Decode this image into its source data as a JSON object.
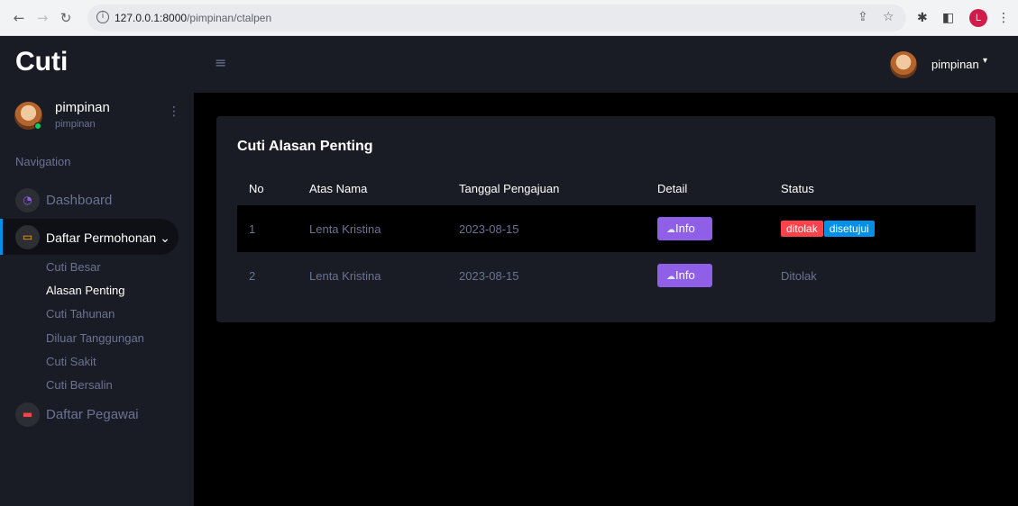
{
  "browser": {
    "url_host": "127.0.0.1:8000",
    "url_path": "/pimpinan/ctalpen",
    "profile_initial": "L"
  },
  "sidebar": {
    "brand": "Cuti",
    "profile": {
      "name": "pimpinan",
      "role": "pimpinan"
    },
    "nav_category": "Navigation",
    "items": [
      {
        "label": "Dashboard",
        "icon": "speedometer-icon",
        "color": "#8f5fe8"
      },
      {
        "label": "Daftar Permohonan ⌄",
        "icon": "laptop-icon",
        "color": "#ffab00"
      },
      {
        "label": "Daftar Pegawai",
        "icon": "chat-icon",
        "color": "#fc424a"
      }
    ],
    "sub_items": [
      {
        "label": "Cuti Besar"
      },
      {
        "label": "Alasan Penting"
      },
      {
        "label": "Cuti Tahunan"
      },
      {
        "label": "Diluar Tanggungan"
      },
      {
        "label": "Cuti Sakit"
      },
      {
        "label": "Cuti Bersalin"
      }
    ]
  },
  "topbar": {
    "username": "pimpinan"
  },
  "main": {
    "card_title": "Cuti Alasan Penting",
    "columns": [
      "No",
      "Atas Nama",
      "Tanggal Pengajuan",
      "Detail",
      "Status"
    ],
    "rows": [
      {
        "no": "1",
        "name": "Lenta Kristina",
        "date": "2023-08-15",
        "detail": "Info",
        "status_badges": [
          "ditolak",
          "disetujui"
        ]
      },
      {
        "no": "2",
        "name": "Lenta Kristina",
        "date": "2023-08-15",
        "detail": "Info",
        "status_text": "Ditolak"
      }
    ]
  },
  "colors": {
    "accent_purple": "#8f5fe8",
    "danger": "#fc424a",
    "info": "#0090e7",
    "panel": "#191c24"
  }
}
